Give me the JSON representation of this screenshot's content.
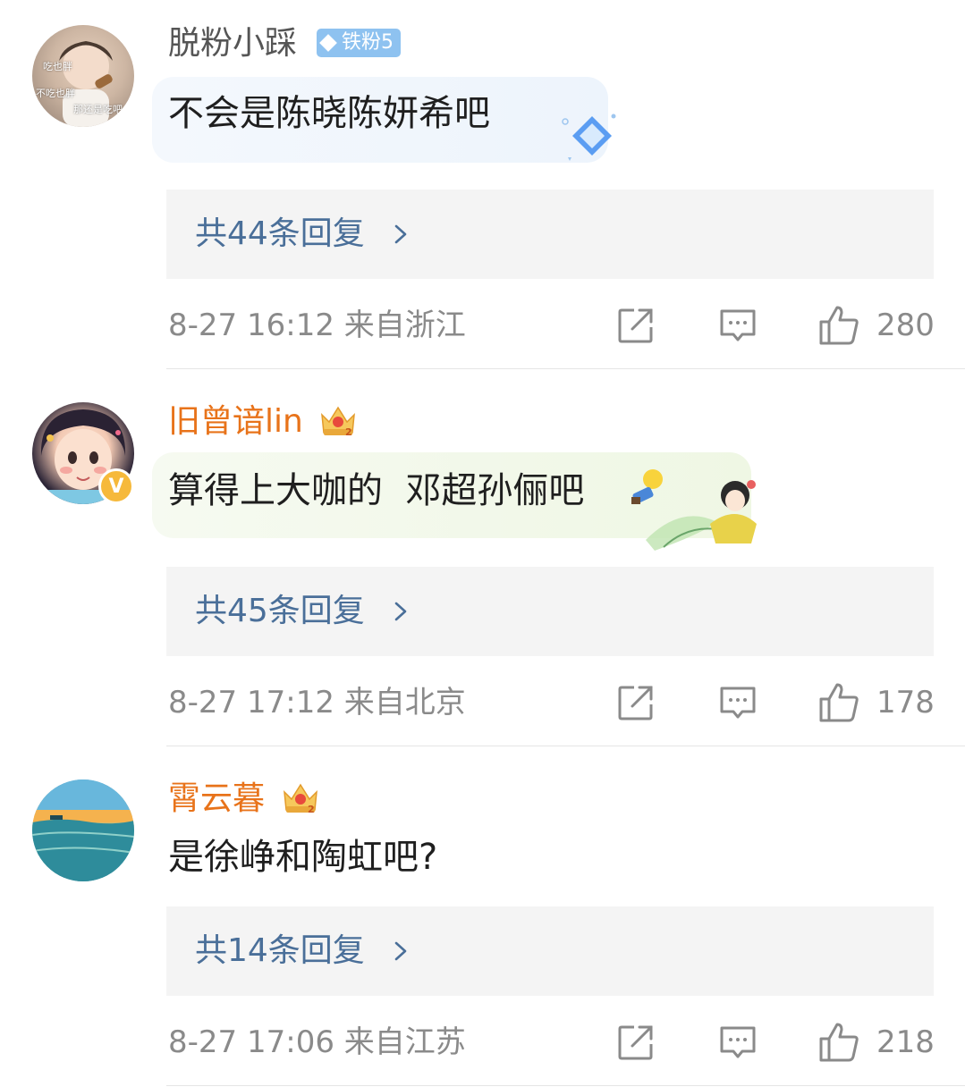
{
  "comments": [
    {
      "username": "脱粉小踩",
      "fan_badge": "铁粉5",
      "text": "不会是陈晓陈妍希吧",
      "avatar_text": [
        "吃也胖",
        "不吃也胖",
        "那还是吃吧"
      ],
      "replies": "共44条回复",
      "time_location": "8-27 16:12  来自浙江",
      "likes": "280"
    },
    {
      "username": "旧曾谙lin",
      "text": "算得上大咖的  邓超孙俪吧",
      "replies": "共45条回复",
      "time_location": "8-27 17:12  来自北京",
      "likes": "178",
      "verified_mark": "V"
    },
    {
      "username": "霄云暮",
      "text": "是徐峥和陶虹吧?",
      "replies": "共14条回复",
      "time_location": "8-27 17:06  来自江苏",
      "likes": "218"
    }
  ],
  "icons": {
    "share": "share-icon",
    "comment": "comment-icon",
    "like": "like-icon",
    "chevron": "chevron-right-icon",
    "crown": "crown-badge-icon"
  },
  "colors": {
    "username_gray": "#555555",
    "username_orange": "#e8731a",
    "link_blue": "#4a6f99",
    "meta_gray": "#8a8a8a",
    "reply_box": "#f4f4f4",
    "fan_badge": "#8ec2f0"
  }
}
